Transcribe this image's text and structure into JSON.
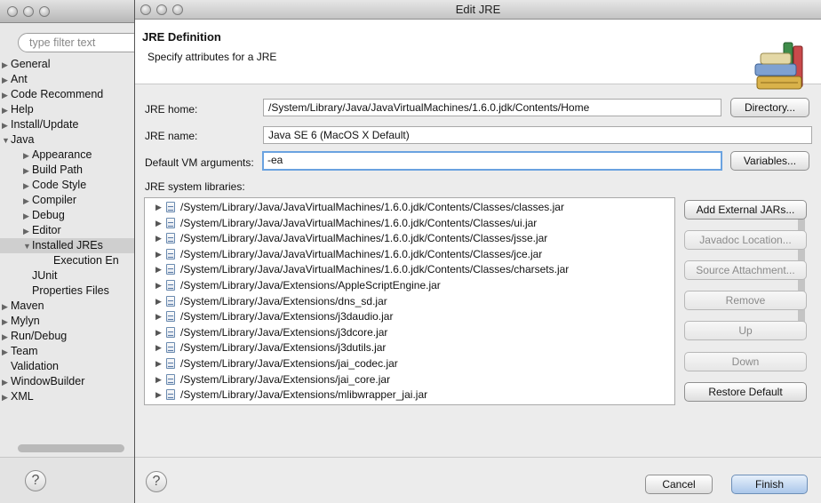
{
  "prefs": {
    "filter_placeholder": "type filter text",
    "tree": [
      {
        "label": "General",
        "arrow": "▶",
        "indent": 0
      },
      {
        "label": "Ant",
        "arrow": "▶",
        "indent": 0
      },
      {
        "label": "Code Recommend",
        "arrow": "▶",
        "indent": 0
      },
      {
        "label": "Help",
        "arrow": "▶",
        "indent": 0
      },
      {
        "label": "Install/Update",
        "arrow": "▶",
        "indent": 0
      },
      {
        "label": "Java",
        "arrow": "▼",
        "indent": 0
      },
      {
        "label": "Appearance",
        "arrow": "▶",
        "indent": 1
      },
      {
        "label": "Build Path",
        "arrow": "▶",
        "indent": 1
      },
      {
        "label": "Code Style",
        "arrow": "▶",
        "indent": 1
      },
      {
        "label": "Compiler",
        "arrow": "▶",
        "indent": 1
      },
      {
        "label": "Debug",
        "arrow": "▶",
        "indent": 1
      },
      {
        "label": "Editor",
        "arrow": "▶",
        "indent": 1
      },
      {
        "label": "Installed JREs",
        "arrow": "▼",
        "indent": 1,
        "selected": true
      },
      {
        "label": "Execution En",
        "arrow": "",
        "indent": 2
      },
      {
        "label": "JUnit",
        "arrow": "",
        "indent": 1
      },
      {
        "label": "Properties Files",
        "arrow": "",
        "indent": 1
      },
      {
        "label": "Maven",
        "arrow": "▶",
        "indent": 0
      },
      {
        "label": "Mylyn",
        "arrow": "▶",
        "indent": 0
      },
      {
        "label": "Run/Debug",
        "arrow": "▶",
        "indent": 0
      },
      {
        "label": "Team",
        "arrow": "▶",
        "indent": 0
      },
      {
        "label": "Validation",
        "arrow": "",
        "indent": 0
      },
      {
        "label": "WindowBuilder",
        "arrow": "▶",
        "indent": 0
      },
      {
        "label": "XML",
        "arrow": "▶",
        "indent": 0
      }
    ],
    "help_glyph": "?"
  },
  "dialog": {
    "title": "Edit JRE",
    "heading": "JRE Definition",
    "description": "Specify attributes for a JRE",
    "jre_home_label": "JRE home:",
    "jre_home_value": "/System/Library/Java/JavaVirtualMachines/1.6.0.jdk/Contents/Home",
    "directory_button": "Directory...",
    "jre_name_label": "JRE name:",
    "jre_name_value": "Java SE 6 (MacOS X Default)",
    "vm_args_label": "Default VM arguments:",
    "vm_args_value": "-ea",
    "variables_button": "Variables...",
    "libraries_label": "JRE system libraries:",
    "libraries": [
      "/System/Library/Java/JavaVirtualMachines/1.6.0.jdk/Contents/Classes/classes.jar",
      "/System/Library/Java/JavaVirtualMachines/1.6.0.jdk/Contents/Classes/ui.jar",
      "/System/Library/Java/JavaVirtualMachines/1.6.0.jdk/Contents/Classes/jsse.jar",
      "/System/Library/Java/JavaVirtualMachines/1.6.0.jdk/Contents/Classes/jce.jar",
      "/System/Library/Java/JavaVirtualMachines/1.6.0.jdk/Contents/Classes/charsets.jar",
      "/System/Library/Java/Extensions/AppleScriptEngine.jar",
      "/System/Library/Java/Extensions/dns_sd.jar",
      "/System/Library/Java/Extensions/j3daudio.jar",
      "/System/Library/Java/Extensions/j3dcore.jar",
      "/System/Library/Java/Extensions/j3dutils.jar",
      "/System/Library/Java/Extensions/jai_codec.jar",
      "/System/Library/Java/Extensions/jai_core.jar",
      "/System/Library/Java/Extensions/mlibwrapper_jai.jar"
    ],
    "side_buttons": {
      "add_external_jars": "Add External JARs...",
      "javadoc_location": "Javadoc Location...",
      "source_attachment": "Source Attachment...",
      "remove": "Remove",
      "up": "Up",
      "down": "Down",
      "restore_default": "Restore Default"
    },
    "cancel_button": "Cancel",
    "finish_button": "Finish",
    "help_glyph": "?",
    "focus_color": "#6aa2e0"
  }
}
